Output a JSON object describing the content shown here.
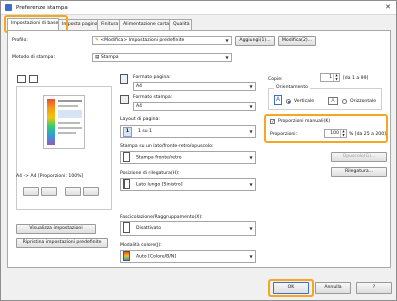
{
  "window": {
    "title": "Preferenze stampa",
    "close_glyph": "✕"
  },
  "tabs": [
    {
      "label": "Impostazioni di base"
    },
    {
      "label": "Imposta pagina"
    },
    {
      "label": "Finitura"
    },
    {
      "label": "Alimentazione carta"
    },
    {
      "label": "Qualità"
    }
  ],
  "profile": {
    "label": "Profilo:",
    "value": "<Modifica> Impostazioni predefinite",
    "add_button": "Aggiungi(1)...",
    "modify_button": "Modifica(2)..."
  },
  "print_method": {
    "label": "Metodo di stampa:",
    "value": "Stampa"
  },
  "page_size": {
    "label": "Formato pagina:",
    "value": "A4"
  },
  "output_size": {
    "label": "Formato stampa:",
    "value": "A4"
  },
  "layout": {
    "label": "Layout di pagina:",
    "value": "1 su 1",
    "icon_number": "1"
  },
  "duplex": {
    "label": "Stampa su un lato/fronte-retro/opuscolo:",
    "value": "Stampa fronte/retro"
  },
  "binding": {
    "label": "Posizione di rilegatura(H):",
    "value": "Lato lungo [Sinistro]",
    "button": "Rilegatura..."
  },
  "collate": {
    "label": "Fascicolazione/Raggruppamento(X):",
    "value": "Disattivato"
  },
  "color_mode": {
    "label": "Modalità colore(J):",
    "value": "Auto [Colore/B/N]"
  },
  "copies": {
    "label": "Copie:",
    "value": "1",
    "range": "[da 1 a 99]"
  },
  "orientation": {
    "label": "Orientamento",
    "portrait": "Verticale",
    "landscape": "Orizzontale",
    "portrait_glyph": "A",
    "landscape_glyph": "A"
  },
  "manual_scaling": {
    "label": "Proporzioni manuali(K)",
    "checked": true,
    "check_glyph": "✓"
  },
  "scaling": {
    "label": "Proporzioni:",
    "value": "100",
    "range": "% [da 25 a 200]"
  },
  "booklet_button": "Opuscolo(G)...",
  "preview_caption": "A4 -> A4 [Proporzioni: 100%]",
  "view_settings_button": "Visualizza impostazioni",
  "restore_defaults_button": "Ripristina impostazioni predefinite",
  "footer": {
    "ok": "OK",
    "cancel": "Annulla",
    "help": "?"
  }
}
